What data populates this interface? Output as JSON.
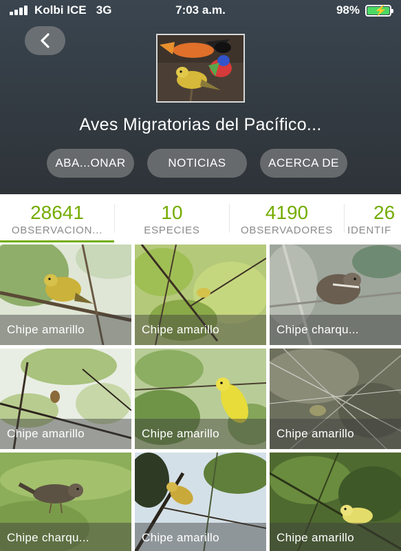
{
  "status_bar": {
    "carrier": "Kolbi ICE",
    "network": "3G",
    "time": "7:03 a.m.",
    "battery_percent": "98%"
  },
  "project": {
    "title": "Aves Migratorias del Pacífico..."
  },
  "actions": {
    "leave_label": "ABA...ONAR",
    "news_label": "NOTICIAS",
    "about_label": "ACERCA DE"
  },
  "stats": [
    {
      "value": "28641",
      "label": "OBSERVACION..."
    },
    {
      "value": "10",
      "label": "ESPECIES"
    },
    {
      "value": "4190",
      "label": "OBSERVADORES"
    },
    {
      "value": "26",
      "label": "IDENTIF"
    }
  ],
  "observations": [
    {
      "caption": "Chipe amarillo"
    },
    {
      "caption": "Chipe amarillo"
    },
    {
      "caption": "Chipe charqu..."
    },
    {
      "caption": "Chipe amarillo"
    },
    {
      "caption": "Chipe amarillo"
    },
    {
      "caption": "Chipe amarillo"
    },
    {
      "caption": "Chipe charqu..."
    },
    {
      "caption": "Chipe amarillo"
    },
    {
      "caption": "Chipe amarillo"
    }
  ],
  "colors": {
    "accent": "#74ac00",
    "header_bg": "#343d44",
    "battery": "#4cd964"
  },
  "icons": {
    "back": "chevron-left-icon",
    "signal": "signal-bars-icon",
    "battery": "battery-charging-icon"
  }
}
